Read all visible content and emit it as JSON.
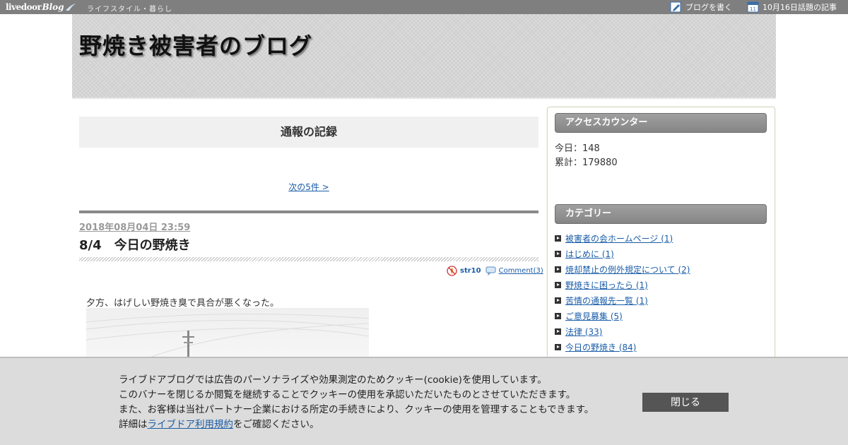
{
  "topbar": {
    "logo_livedoor": "livedoor",
    "logo_blog": "Blog",
    "category": "ライフスタイル・暮らし",
    "write_label": "ブログを書く",
    "topic_label": "10月16日話題の記事",
    "calendar_day": "11"
  },
  "header": {
    "blog_title": "野焼き被害者のブログ"
  },
  "main": {
    "category_title": "通報の記録",
    "next_link": "次の5件 >",
    "post": {
      "date": "2018年08月04日 23:59",
      "title": "8/4　今日の野焼き",
      "author": "str10",
      "comment_link": "Comment(3)",
      "body": "夕方、はげしい野焼き臭で具合が悪くなった。"
    }
  },
  "sidebar": {
    "access_heading": "アクセスカウンター",
    "today": "今日：148",
    "total": "累計：179880",
    "category_heading": "カテゴリー",
    "categories": [
      "被害者の会ホームページ (1)",
      "はじめに (1)",
      "焼却禁止の例外規定について (2)",
      "野焼きに困ったら (1)",
      "苦情の通報先一覧 (1)",
      "ご意見募集 (5)",
      "法律 (33)",
      "今日の野焼き (84)"
    ]
  },
  "cookie": {
    "line1": "ライブドアブログでは広告のパーソナライズや効果測定のためクッキー(cookie)を使用しています。",
    "line2": "このバナーを閉じるか閲覧を継続することでクッキーの使用を承認いただいたものとさせていただきます。",
    "line3": "また、お客様は当社パートナー企業における所定の手続きにより、クッキーの使用を管理することもできます。",
    "line4_prefix": "詳細は",
    "line4_link": "ライブドア利用規約",
    "line4_suffix": "をご確認ください。",
    "close_label": "閉じる"
  },
  "colors": {
    "topbar_bg": "#7f7f7f",
    "link": "#1a5da8",
    "sidebar_heading": "#8f8f8f",
    "cookie_bg": "#dcdcdc",
    "close_button": "#555555"
  }
}
